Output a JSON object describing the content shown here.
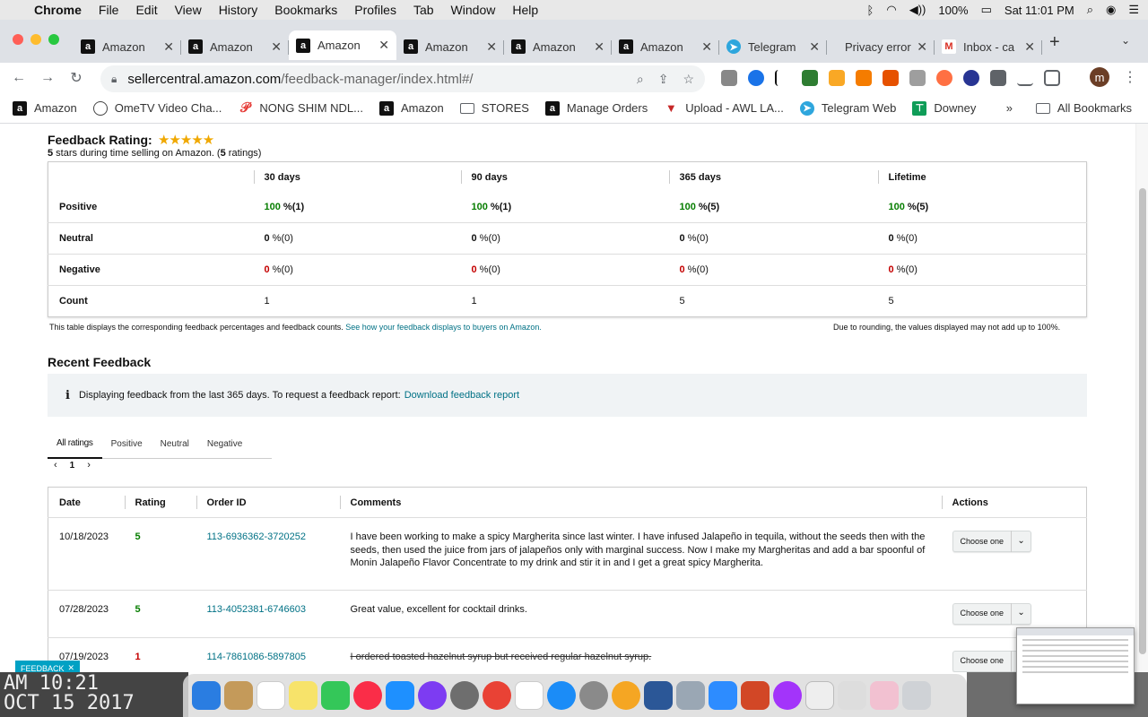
{
  "menubar": {
    "app": "Chrome",
    "items": [
      "File",
      "Edit",
      "View",
      "History",
      "Bookmarks",
      "Profiles",
      "Tab",
      "Window",
      "Help"
    ],
    "battery": "100%",
    "clock": "Sat 11:01 PM"
  },
  "tabs": [
    {
      "title": "Amazon",
      "icon": "a"
    },
    {
      "title": "Amazon",
      "icon": "a"
    },
    {
      "title": "Amazon",
      "icon": "a",
      "active": true
    },
    {
      "title": "Amazon",
      "icon": "a"
    },
    {
      "title": "Amazon",
      "icon": "a"
    },
    {
      "title": "Amazon",
      "icon": "a"
    },
    {
      "title": "Telegram",
      "icon": "tg"
    },
    {
      "title": "Privacy error",
      "icon": "none"
    },
    {
      "title": "Inbox - ca",
      "icon": "gm"
    }
  ],
  "address": {
    "host": "sellercentral.amazon.com",
    "path": "/feedback-manager/index.html#/"
  },
  "profile_initial": "m",
  "bookmarks": [
    "Amazon",
    "OmeTV Video Cha...",
    "NONG SHIM NDL...",
    "Amazon",
    "STORES",
    "Manage Orders",
    "Upload - AWL LA...",
    "Telegram Web",
    "Downey"
  ],
  "bookmarks_overflow": "»",
  "all_bookmarks": "All Bookmarks",
  "rating": {
    "title": "Feedback Rating:",
    "stars": "★★★★★",
    "stars_value": 5,
    "subtitle_num": "5",
    "subtitle_mid": " stars during time selling on Amazon. (",
    "subtitle_count": "5",
    "subtitle_end": " ratings)",
    "headers": [
      "30 days",
      "90 days",
      "365 days",
      "Lifetime"
    ],
    "rows": [
      {
        "label": "Positive",
        "cells": [
          {
            "v": "100",
            "s": " %(1)"
          },
          {
            "v": "100",
            "s": " %(1)"
          },
          {
            "v": "100",
            "s": " %(5)"
          },
          {
            "v": "100",
            "s": " %(5)"
          }
        ]
      },
      {
        "label": "Neutral",
        "cells": [
          {
            "v": "0",
            "s": " %(0)"
          },
          {
            "v": "0",
            "s": " %(0)"
          },
          {
            "v": "0",
            "s": " %(0)"
          },
          {
            "v": "0",
            "s": " %(0)"
          }
        ]
      },
      {
        "label": "Negative",
        "cells": [
          {
            "v": "0",
            "s": " %(0)"
          },
          {
            "v": "0",
            "s": " %(0)"
          },
          {
            "v": "0",
            "s": " %(0)"
          },
          {
            "v": "0",
            "s": " %(0)"
          }
        ]
      },
      {
        "label": "Count",
        "cells": [
          {
            "v": "1",
            "s": ""
          },
          {
            "v": "1",
            "s": ""
          },
          {
            "v": "5",
            "s": ""
          },
          {
            "v": "5",
            "s": ""
          }
        ]
      }
    ],
    "note": "This table displays the corresponding feedback percentages and feedback counts.",
    "note_link": "See how your feedback displays to buyers on Amazon.",
    "note_right": "Due to rounding, the values displayed may not add up to 100%."
  },
  "recent": {
    "title": "Recent Feedback",
    "info": "Displaying feedback from the last 365 days. To request a feedback report:",
    "info_link": "Download feedback report",
    "filters": [
      "All ratings",
      "Positive",
      "Neutral",
      "Negative"
    ],
    "page": "1",
    "columns": [
      "Date",
      "Rating",
      "Order ID",
      "Comments",
      "Actions"
    ],
    "action_label": "Choose one",
    "rows": [
      {
        "date": "10/18/2023",
        "rating": "5",
        "order": "113-6936362-3720252",
        "comment": "I have been working to make a spicy Margherita since last winter. I have infused Jalapeño in tequila, without the seeds then with the seeds, then used the juice from jars of jalapeños only with marginal success. Now I make my Margheritas and add a bar spoonful of Monin Jalapeño Flavor Concentrate to my drink and stir it in and I get a great spicy Margherita."
      },
      {
        "date": "07/28/2023",
        "rating": "5",
        "order": "113-4052381-6746603",
        "comment": "Great value, excellent for cocktail drinks."
      },
      {
        "date": "07/19/2023",
        "rating": "1",
        "order": "114-7861086-5897805",
        "comment": "I ordered toasted hazelnut syrup but received regular hazelnut syrup."
      }
    ]
  },
  "feedback_button": "FEEDBACK",
  "desktop_clock": "AM 10:21\nOCT 15 2017"
}
